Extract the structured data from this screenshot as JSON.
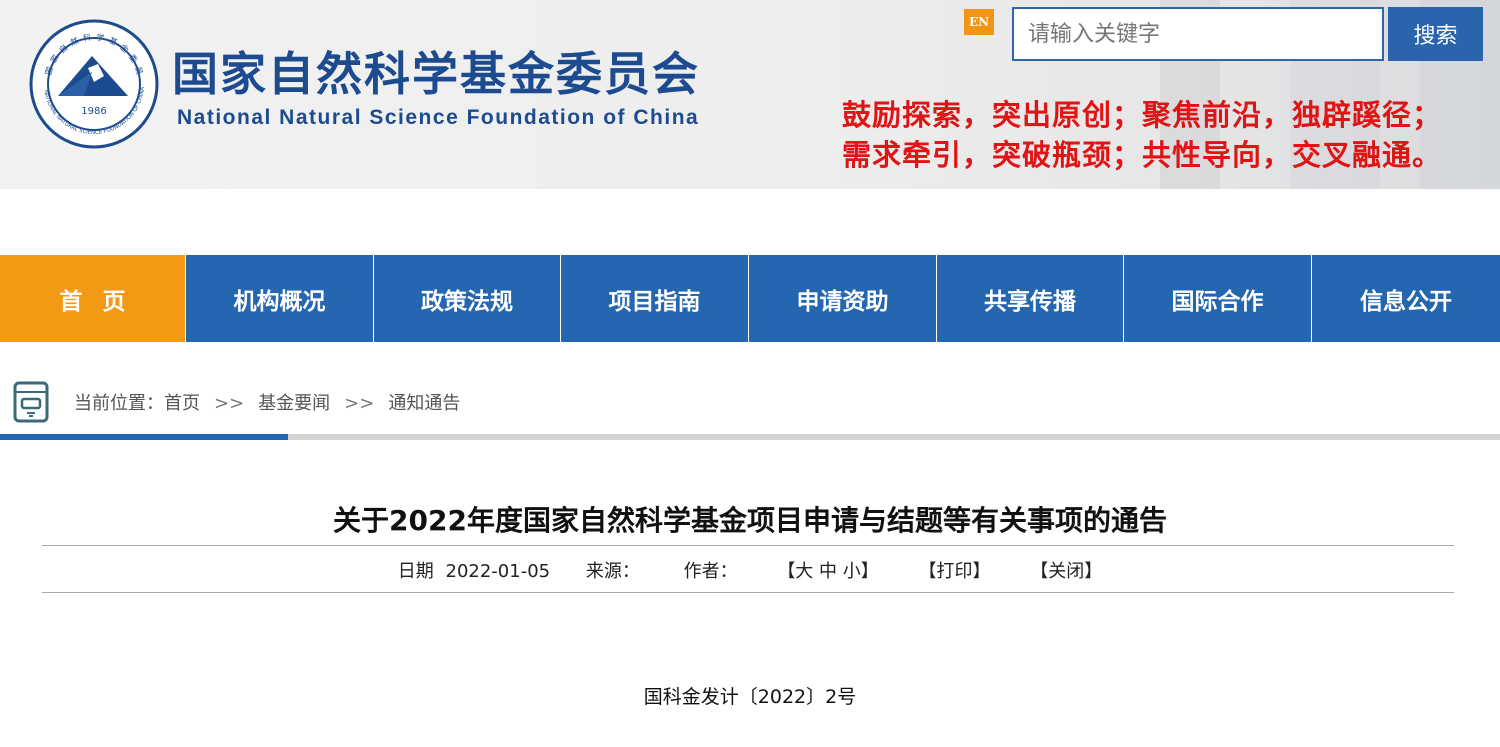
{
  "header": {
    "org_name_cn": "国家自然科学基金委员会",
    "org_name_en": "National Natural Science Foundation of China",
    "logo_year": "1986",
    "en_label": "EN",
    "search_placeholder": "请输入关键字",
    "search_button": "搜索",
    "slogan_line1": "鼓励探索，突出原创；聚焦前沿，独辟蹊径；",
    "slogan_line2": "需求牵引，突破瓶颈；共性导向，交叉融通。"
  },
  "nav": {
    "items": [
      {
        "label": "首页"
      },
      {
        "label": "机构概况"
      },
      {
        "label": "政策法规"
      },
      {
        "label": "项目指南"
      },
      {
        "label": "申请资助"
      },
      {
        "label": "共享传播"
      },
      {
        "label": "国际合作"
      },
      {
        "label": "信息公开"
      }
    ],
    "active_index": 0
  },
  "breadcrumb": {
    "prefix": "当前位置：",
    "items": [
      "首页",
      "基金要闻",
      "通知通告"
    ],
    "separator": ">>"
  },
  "article": {
    "title": "关于2022年度国家自然科学基金项目申请与结题等有关事项的通告",
    "date_label": "日期",
    "date": "2022-01-05",
    "source_label": "来源：",
    "author_label": "作者：",
    "font_size_control": "【大 中 小】",
    "print_label": "【打印】",
    "close_label": "【关闭】",
    "doc_number": "国科金发计〔2022〕2号"
  },
  "colors": {
    "brand_blue": "#2467b0",
    "active_orange": "#f39914",
    "slogan_red": "#e01414"
  }
}
